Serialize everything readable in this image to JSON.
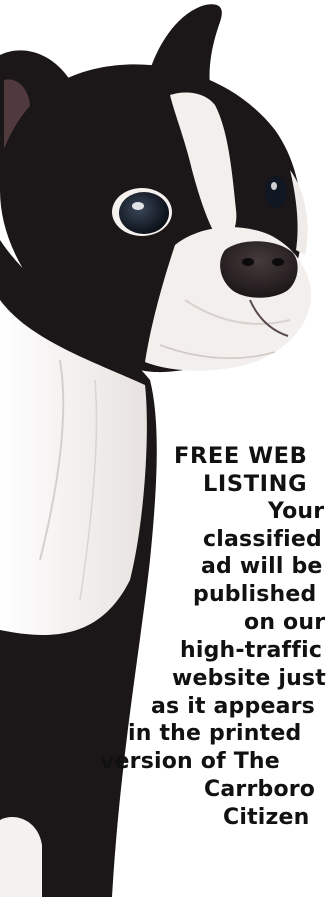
{
  "ad": {
    "image": {
      "icon": "boston-terrier-photo",
      "colors": {
        "fur_black": "#1b1617",
        "fur_white": "#f2efed",
        "nose": "#2a2224",
        "eye": "#0f1722",
        "pink_ear": "#7d5a5c"
      }
    },
    "headline": [
      "FREE WEB",
      "LISTING"
    ],
    "body": [
      "Your",
      "classified",
      "ad will be",
      "published",
      "on our",
      "high-traffic",
      "website just",
      "as it appears",
      "in the printed",
      "version of  The",
      "Carrboro",
      "Citizen"
    ]
  }
}
